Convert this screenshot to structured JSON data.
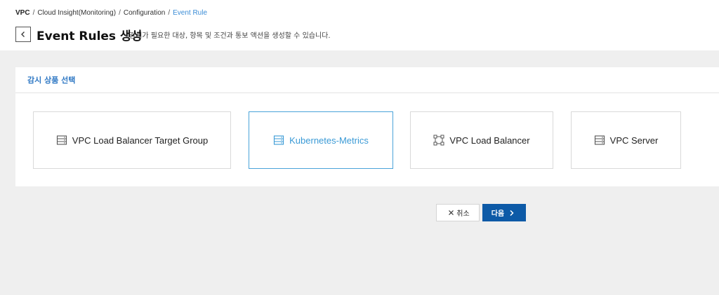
{
  "breadcrumb": {
    "items": [
      "VPC",
      "Cloud Insight(Monitoring)",
      "Configuration",
      "Event Rule"
    ],
    "separator": "/"
  },
  "header": {
    "title": "Event Rules 생성",
    "description": "감시가 필요한 대상, 항목 및 조건과 통보 액션을 생성할 수 있습니다."
  },
  "panel": {
    "title": "감시 상품 선택",
    "products": [
      {
        "label": "VPC Load Balancer Target Group",
        "icon": "server-list-icon",
        "selected": false
      },
      {
        "label": "Kubernetes-Metrics",
        "icon": "server-list-icon",
        "selected": true
      },
      {
        "label": "VPC Load Balancer",
        "icon": "load-balancer-icon",
        "selected": false
      },
      {
        "label": "VPC Server",
        "icon": "server-list-icon",
        "selected": false
      }
    ]
  },
  "actions": {
    "cancel_label": "취소",
    "next_label": "다음"
  },
  "colors": {
    "accent": "#3a8cd6",
    "primary_button": "#0d5aa7",
    "selected_border": "#4aa3d9",
    "page_bg": "#efefef"
  }
}
